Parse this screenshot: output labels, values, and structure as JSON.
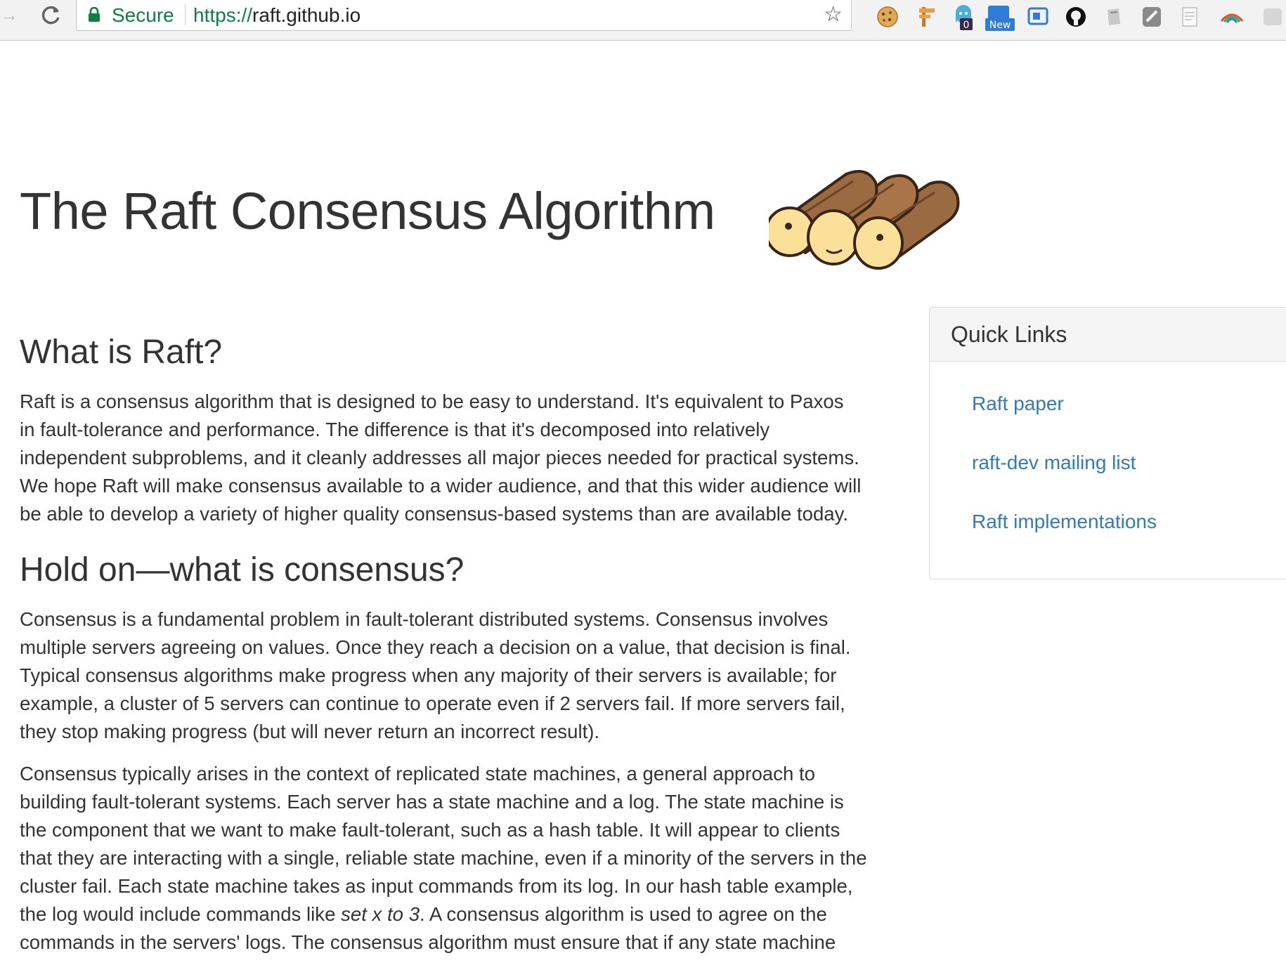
{
  "browser": {
    "secure_label": "Secure",
    "url_scheme": "https://",
    "url_host": "raft.github.io",
    "extensions": [
      "cookie-icon",
      "signpost-icon",
      "ghostery-icon",
      "new-badge-icon",
      "feedly-icon",
      "github-icon",
      "evernote-icon",
      "shield-icon",
      "notepad-icon",
      "rainbow-icon",
      "blank-icon"
    ],
    "badges": {
      "ghostery_count": "0",
      "new_label": "New"
    }
  },
  "page": {
    "title": "The Raft Consensus Algorithm",
    "sections": [
      {
        "heading": "What is Raft?",
        "paragraphs": [
          [
            "Raft is a consensus algorithm that is designed to be easy to understand. It's equivalent to Paxos",
            "in fault-tolerance and performance. The difference is that it's decomposed into relatively",
            "independent subproblems, and it cleanly addresses all major pieces needed for practical systems.",
            "We hope Raft will make consensus available to a wider audience, and that this wider audience will",
            "be able to develop a variety of higher quality consensus-based systems than are available today."
          ]
        ]
      },
      {
        "heading": "Hold on—what is consensus?",
        "paragraphs": [
          [
            "Consensus is a fundamental problem in fault-tolerant distributed systems. Consensus involves",
            "multiple servers agreeing on values. Once they reach a decision on a value, that decision is final.",
            "Typical consensus algorithms make progress when any majority of their servers is available; for",
            "example, a cluster of 5 servers can continue to operate even if 2 servers fail. If more servers fail,",
            "they stop making progress (but will never return an incorrect result)."
          ],
          [
            "Consensus typically arises in the context of replicated state machines, a general approach to",
            "building fault-tolerant systems. Each server has a state machine and a log. The state machine is",
            "the component that we want to make fault-tolerant, such as a hash table. It will appear to clients",
            "that they are interacting with a single, reliable state machine, even if a minority of the servers in the",
            "cluster fail. Each state machine takes as input commands from its log. In our hash table example,"
          ]
        ],
        "p2_line6_before": "the log would include commands like ",
        "p2_line6_italic": "set x to 3",
        "p2_line6_after": ". A consensus algorithm is used to agree on the",
        "p2_line7": "commands in the servers' logs. The consensus algorithm must ensure that if any state machine"
      }
    ]
  },
  "quick_links": {
    "title": "Quick Links",
    "links": [
      "Raft paper",
      "raft-dev mailing list",
      "Raft implementations"
    ]
  },
  "colors": {
    "link": "#337ab7",
    "secure_green": "#0b8043",
    "text": "#333333",
    "log_brown": "#9a6b43",
    "log_end": "#fbe09a"
  }
}
